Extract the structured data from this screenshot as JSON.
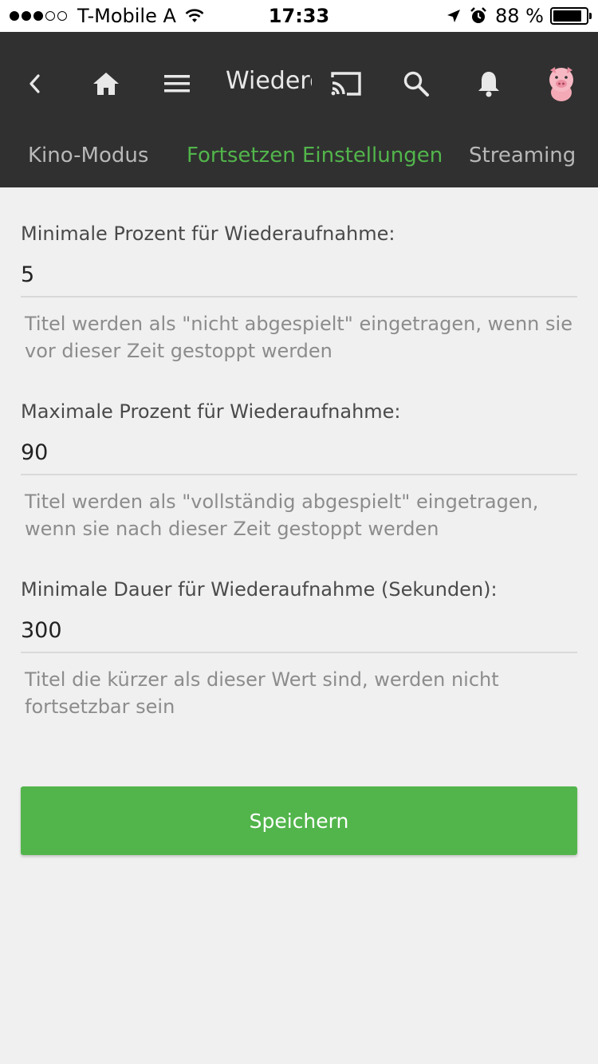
{
  "status_bar": {
    "carrier": "T-Mobile A",
    "time": "17:33",
    "battery": "88 %",
    "battery_level": 0.88
  },
  "toolbar": {
    "title": "Wiederg",
    "icons": [
      "back-icon",
      "home-icon",
      "menu-icon",
      "cast-icon",
      "search-icon",
      "bell-icon",
      "avatar-pig"
    ]
  },
  "tabs": [
    {
      "label": "Kino-Modus",
      "active": false
    },
    {
      "label": "Fortsetzen Einstellungen",
      "active": true
    },
    {
      "label": "Streaming",
      "active": false
    }
  ],
  "fields": [
    {
      "label": "Minimale Prozent für Wiederaufnahme:",
      "value": "5",
      "description": "Titel werden als \"nicht abgespielt\" eingetragen, wenn sie vor dieser Zeit gestoppt werden"
    },
    {
      "label": "Maximale Prozent für Wiederaufnahme:",
      "value": "90",
      "description": "Titel werden als \"vollständig abgespielt\" eingetragen, wenn sie nach dieser Zeit gestoppt werden"
    },
    {
      "label": "Minimale Dauer für Wiederaufnahme (Sekunden):",
      "value": "300",
      "description": "Titel die kürzer als dieser Wert sind, werden nicht fortsetzbar sein"
    }
  ],
  "save_button": {
    "label": "Speichern"
  },
  "colors": {
    "accent": "#52b54b",
    "header": "#303030",
    "background": "#f0f0f0"
  }
}
